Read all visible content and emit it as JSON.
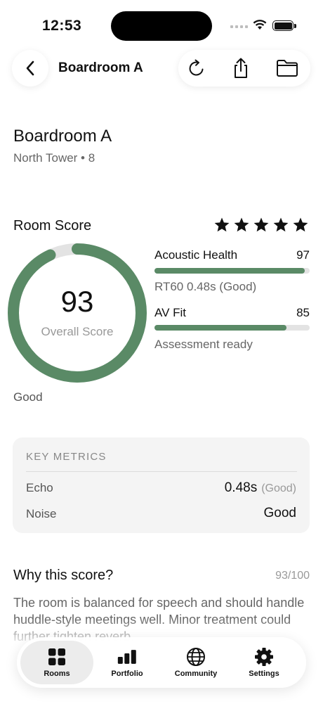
{
  "status_bar": {
    "time": "12:53"
  },
  "nav": {
    "title": "Boardroom A"
  },
  "room": {
    "name": "Boardroom A",
    "subtitle": "North Tower • 8"
  },
  "score": {
    "heading": "Room Score",
    "stars": 5,
    "value": "93",
    "fraction": 0.93,
    "label": "Overall Score",
    "band": "Good",
    "metrics": [
      {
        "name": "Acoustic Health",
        "value": "97",
        "fraction": 0.97,
        "note": "RT60 0.48s (Good)"
      },
      {
        "name": "AV Fit",
        "value": "85",
        "fraction": 0.85,
        "note": "Assessment ready"
      }
    ]
  },
  "key_metrics": {
    "title": "KEY METRICS",
    "rows": [
      {
        "label": "Echo",
        "value": "0.48s",
        "qualifier": "(Good)"
      },
      {
        "label": "Noise",
        "value": "Good",
        "qualifier": ""
      }
    ]
  },
  "why": {
    "title": "Why this score?",
    "score": "93/100",
    "text": "The room is balanced for speech and should handle huddle-style meetings well. Minor treatment could further tighten reverb."
  },
  "tabs": [
    {
      "label": "Rooms",
      "icon": "grid-icon",
      "active": true
    },
    {
      "label": "Portfolio",
      "icon": "bar-chart-icon",
      "active": false
    },
    {
      "label": "Community",
      "icon": "globe-icon",
      "active": false
    },
    {
      "label": "Settings",
      "icon": "gear-icon",
      "active": false
    }
  ],
  "colors": {
    "accent": "#5a8a66",
    "track": "#e3e3e3",
    "card": "#f4f4f4"
  }
}
